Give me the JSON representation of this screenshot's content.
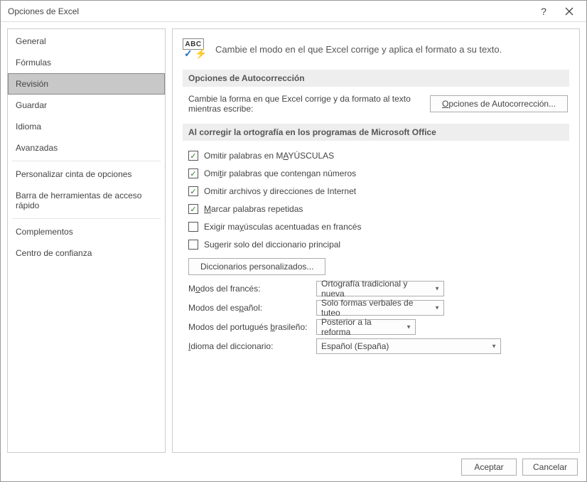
{
  "title": "Opciones de Excel",
  "sidebar": {
    "items": [
      "General",
      "Fórmulas",
      "Revisión",
      "Guardar",
      "Idioma",
      "Avanzadas",
      "Personalizar cinta de opciones",
      "Barra de herramientas de acceso rápido",
      "Complementos",
      "Centro de confianza"
    ],
    "selectedIndex": 2
  },
  "intro": "Cambie el modo en el que Excel corrige y aplica el formato a su texto.",
  "section_autocorr_h": "Opciones de Autocorrección",
  "autocorr_desc": "Cambie la forma en que Excel corrige y da formato al texto mientras escribe:",
  "autocorr_btn": "Opciones de Autocorrección...",
  "section_spell_h": "Al corregir la ortografía en los programas de Microsoft Office",
  "checks": {
    "uppercase": "Omitir palabras en MAYÚSCULAS",
    "numbers": "Omitir palabras que contengan números",
    "internet": "Omitir archivos y direcciones de Internet",
    "repeated": "Marcar palabras repetidas",
    "french_acc": "Exigir mayúsculas acentuadas en francés",
    "main_dict": "Sugerir solo del diccionario principal"
  },
  "dict_btn": "Diccionarios personalizados...",
  "selects": {
    "french_label": "Modos del francés:",
    "french_value": "Ortografía tradicional y nueva",
    "spanish_label": "Modos del español:",
    "spanish_value": "Solo formas verbales de tuteo",
    "pt_label": "Modos del portugués brasileño:",
    "pt_value": "Posterior a la reforma",
    "dict_lang_label": "Idioma del diccionario:",
    "dict_lang_value": "Español (España)"
  },
  "footer": {
    "ok": "Aceptar",
    "cancel": "Cancelar"
  }
}
